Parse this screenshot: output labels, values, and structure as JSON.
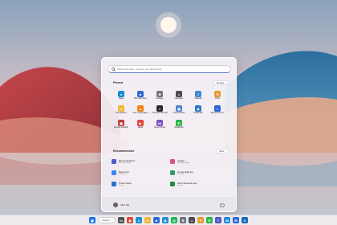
{
  "search": {
    "placeholder": "Search for apps, settings, and documents"
  },
  "pinned": {
    "title": "Pinned",
    "all_apps": "All apps",
    "apps": [
      {
        "label": "Edge",
        "icon": "edge-icon",
        "color": "#1b8fd2",
        "glyph": "e"
      },
      {
        "label": "Microsoft Store",
        "icon": "store-icon",
        "color": "#2d6ad1",
        "glyph": "■"
      },
      {
        "label": "Settings",
        "icon": "gear-icon",
        "color": "#6f7480",
        "glyph": "⚙"
      },
      {
        "label": "Calculator",
        "icon": "calculator-icon",
        "color": "#4a4a54",
        "glyph": "="
      },
      {
        "label": "Notepad",
        "icon": "notepad-icon",
        "color": "#3d8ad6",
        "glyph": "≡"
      },
      {
        "label": "Paint",
        "icon": "paint-icon",
        "color": "#e59b2c",
        "glyph": "✎"
      },
      {
        "label": "File Explorer",
        "icon": "folder-icon",
        "color": "#f1b73a",
        "glyph": "▭"
      },
      {
        "label": "VLC media player",
        "icon": "vlc-icon",
        "color": "#f08418",
        "glyph": "▲"
      },
      {
        "label": "Command Prompt",
        "icon": "terminal-icon",
        "color": "#2b2b2b",
        "glyph": ">"
      },
      {
        "label": "Control Panel",
        "icon": "control-panel-icon",
        "color": "#4b86c9",
        "glyph": "▣"
      },
      {
        "label": "Virtual Box",
        "icon": "virtualbox-icon",
        "color": "#2b79c2",
        "glyph": "◆"
      },
      {
        "label": "Microsoft To Do",
        "icon": "todo-icon",
        "color": "#2a64d4",
        "glyph": "✓"
      },
      {
        "label": "Remote Desktop",
        "icon": "remote-desktop-icon",
        "color": "#c03c3c",
        "glyph": "▦"
      },
      {
        "label": "Media",
        "icon": "media-icon",
        "color": "#e5443f",
        "glyph": "▶"
      },
      {
        "label": "Visual Studio",
        "icon": "visual-studio-icon",
        "color": "#7a4ec5",
        "glyph": "⋈"
      },
      {
        "label": "WhatsApp",
        "icon": "whatsapp-icon",
        "color": "#25b545",
        "glyph": "✆"
      }
    ]
  },
  "recommended": {
    "title": "Recommended",
    "more": "More",
    "items": [
      {
        "name": "Microsoft Teams",
        "time": "Recently added",
        "icon": "teams-icon",
        "color": "#5059c9"
      },
      {
        "name": "Copilot",
        "time": "Recently added",
        "icon": "copilot-icon",
        "color": "#e0508a"
      },
      {
        "name": "Beach.jpg",
        "time": "14m ago",
        "icon": "image-file-icon",
        "color": "#3b82f6"
      },
      {
        "name": "sunset-flight.jpg",
        "time": "21m ago",
        "icon": "image-file-icon",
        "color": "#2d9b6c"
      },
      {
        "name": "Travel Notes",
        "time": "1h ago",
        "icon": "document-icon",
        "color": "#2b6bd6"
      },
      {
        "name": "Work Schedule.xlsx",
        "time": "2h ago",
        "icon": "spreadsheet-icon",
        "color": "#1e8a4c"
      }
    ]
  },
  "user": {
    "name": "Allen Bai"
  },
  "taskbar": {
    "search_label": "Search",
    "items": [
      {
        "icon": "windows-start-icon",
        "color": "#1a73e8",
        "glyph": "▦"
      },
      {
        "icon": "task-view-icon",
        "color": "#555",
        "glyph": "▭"
      },
      {
        "icon": "chrome-icon",
        "color": "#d94a38",
        "glyph": "◉"
      },
      {
        "icon": "edge-icon",
        "color": "#1b8fd2",
        "glyph": "e"
      },
      {
        "icon": "file-explorer-icon",
        "color": "#f1b73a",
        "glyph": "▭"
      },
      {
        "icon": "store-icon",
        "color": "#2d6ad1",
        "glyph": "■"
      },
      {
        "icon": "photos-icon",
        "color": "#1e90d6",
        "glyph": "◈"
      },
      {
        "icon": "spotify-icon",
        "color": "#1db954",
        "glyph": "◎"
      },
      {
        "icon": "settings-icon",
        "color": "#6f7480",
        "glyph": "⚙"
      },
      {
        "icon": "calculator-icon",
        "color": "#4a4a54",
        "glyph": "="
      },
      {
        "icon": "paint-icon",
        "color": "#e59b2c",
        "glyph": "✎"
      },
      {
        "icon": "whatsapp-icon",
        "color": "#25b545",
        "glyph": "✆"
      },
      {
        "icon": "teams-icon",
        "color": "#5059c9",
        "glyph": "T"
      },
      {
        "icon": "vscode-icon",
        "color": "#2a8ad8",
        "glyph": "⋈"
      },
      {
        "icon": "mail-icon",
        "color": "#2b6bd6",
        "glyph": "✉"
      },
      {
        "icon": "outlook-icon",
        "color": "#0f6cbd",
        "glyph": "O"
      }
    ]
  }
}
